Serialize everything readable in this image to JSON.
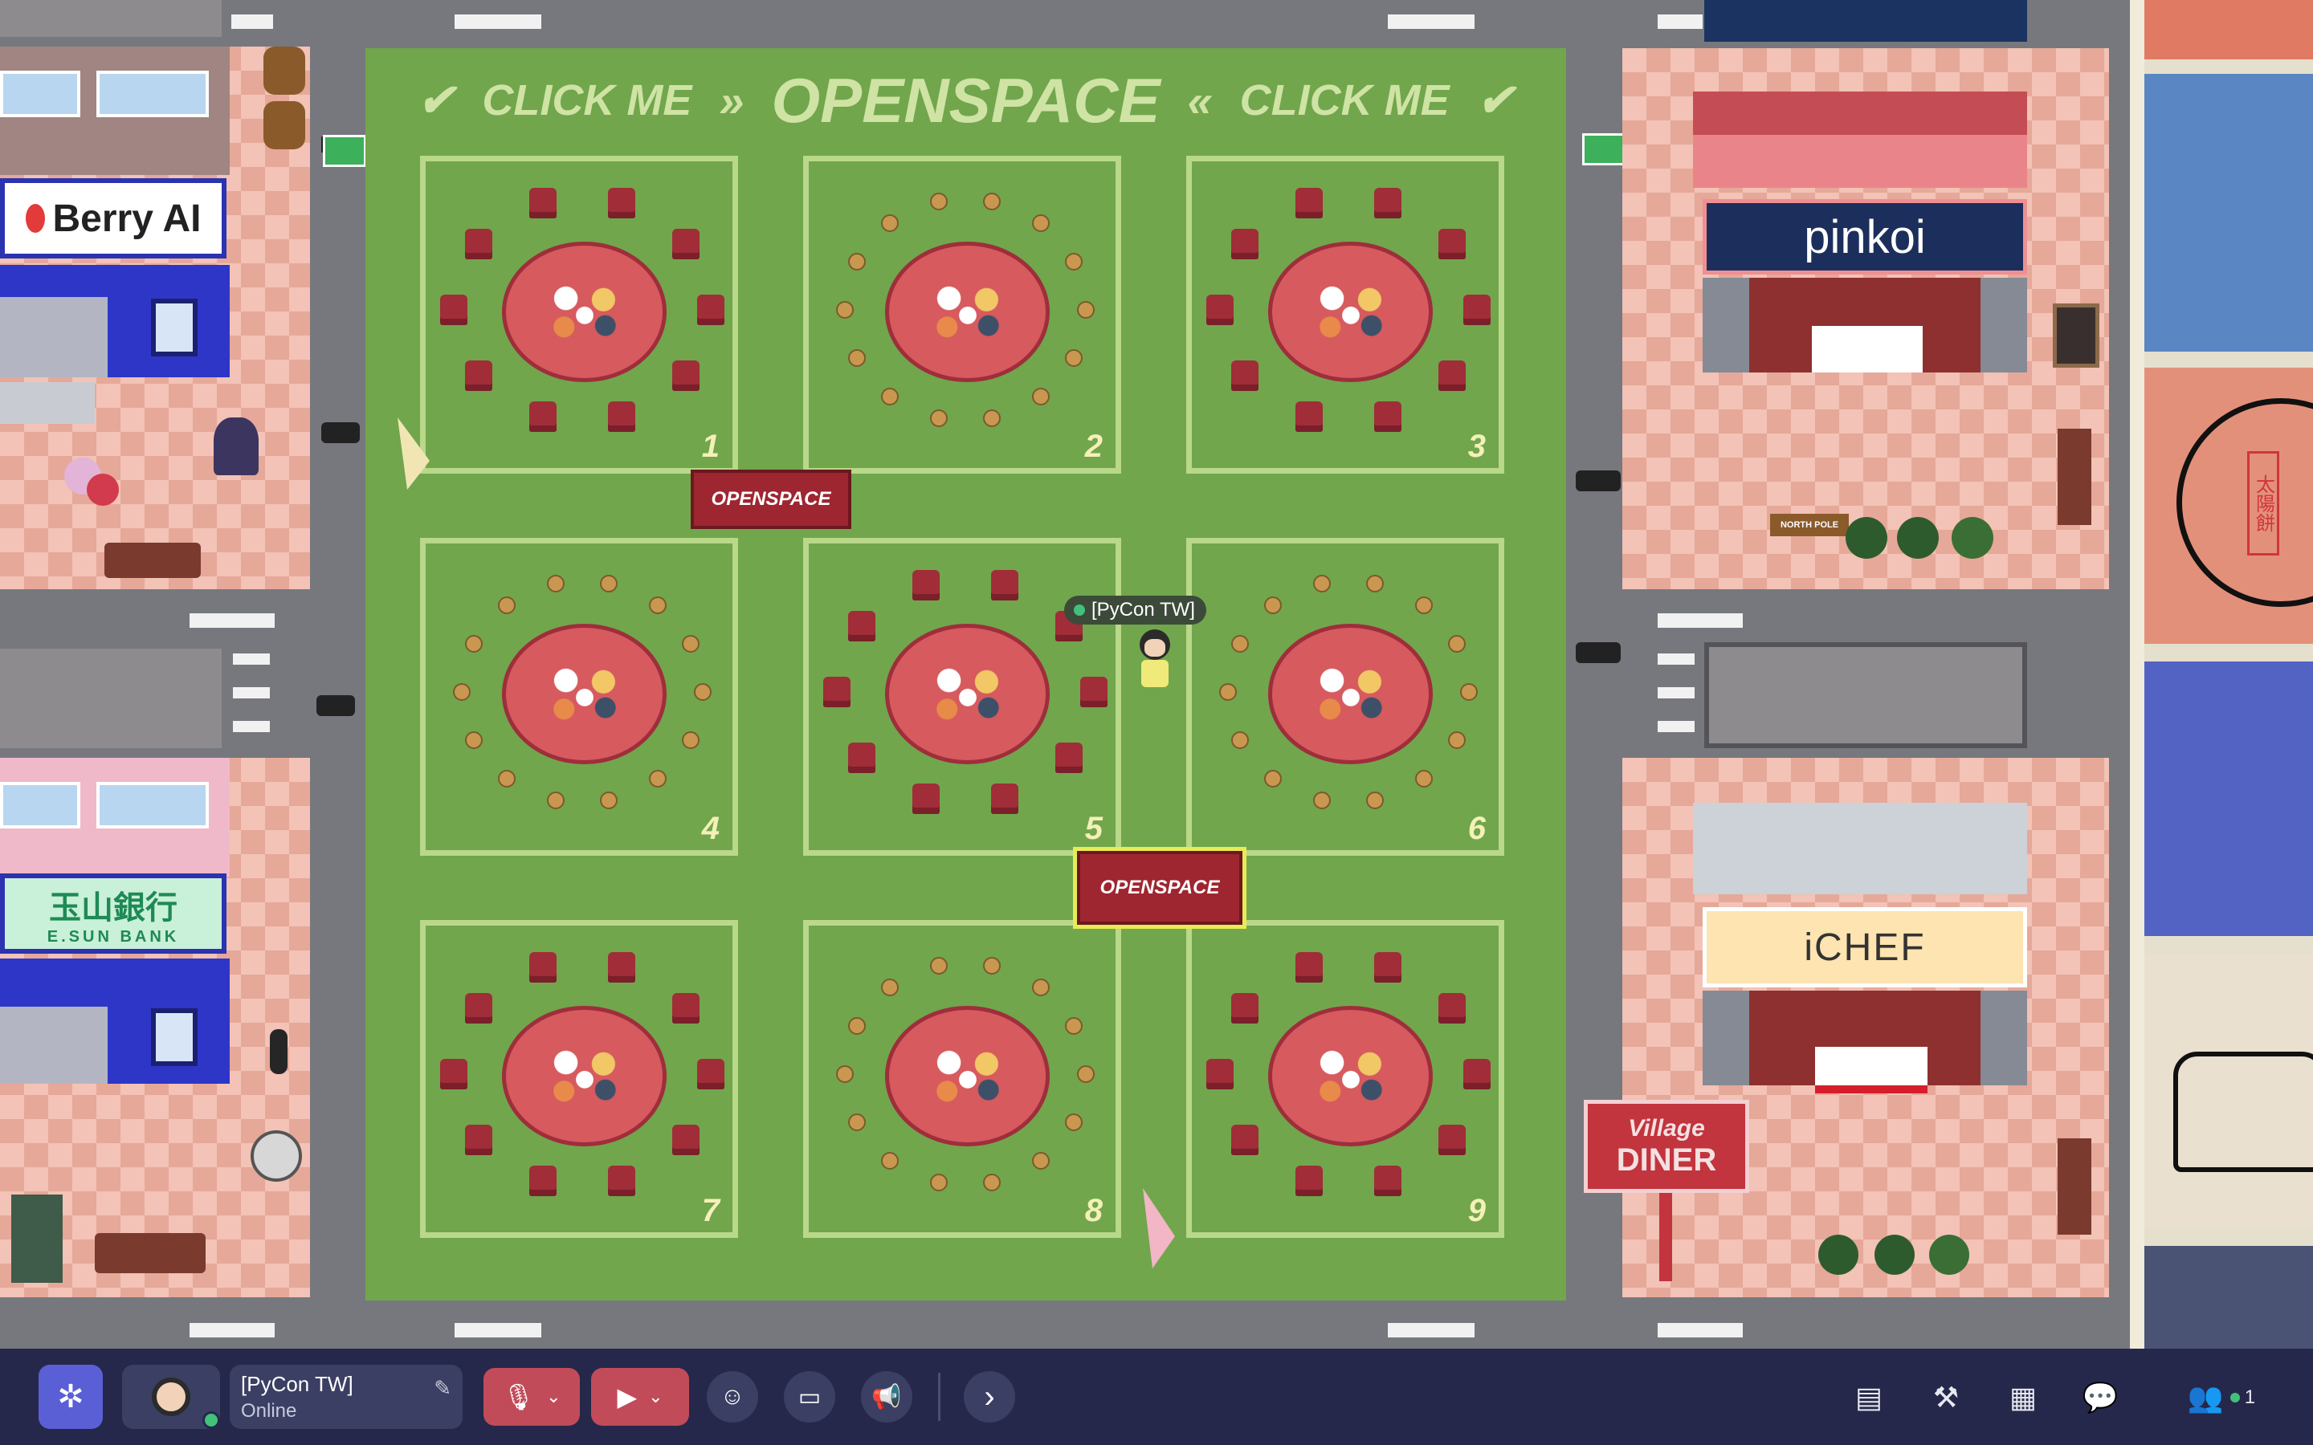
{
  "map": {
    "banner": {
      "left_click": "CLICK ME",
      "title": "OPENSPACE",
      "right_click": "CLICK ME"
    },
    "zones": [
      "1",
      "2",
      "3",
      "4",
      "5",
      "6",
      "7",
      "8",
      "9"
    ],
    "signs": [
      "OPENSPACE",
      "OPENSPACE"
    ],
    "player": {
      "name": "[PyCon TW]"
    },
    "stores": {
      "berry": "Berry AI",
      "esun_cn": "玉山銀行",
      "esun_en": "E.SUN BANK",
      "pinkoi": "pinkoi",
      "ichef": "iCHEF",
      "diner_top": "Village",
      "diner_bottom": "DINER",
      "north_pole": "NORTH POLE",
      "taiyang": "太陽餅"
    }
  },
  "bottombar": {
    "user_name": "[PyCon TW]",
    "user_status": "Online",
    "participants_count": "1",
    "icons": {
      "menu": "grid-network-icon",
      "mic": "mic-muted-icon",
      "cam": "camera-off-icon",
      "emoji": "emoji-icon",
      "screen": "screen-share-icon",
      "announce": "megaphone-icon",
      "more": "chevron-right-icon",
      "build": "hammer-icon",
      "calendar": "calendar-icon",
      "chat": "chat-icon",
      "people": "people-icon"
    },
    "colors": {
      "bar": "#25284a",
      "muted": "#c24b5a",
      "accent": "#5a5fd6",
      "online": "#43c07a"
    }
  }
}
